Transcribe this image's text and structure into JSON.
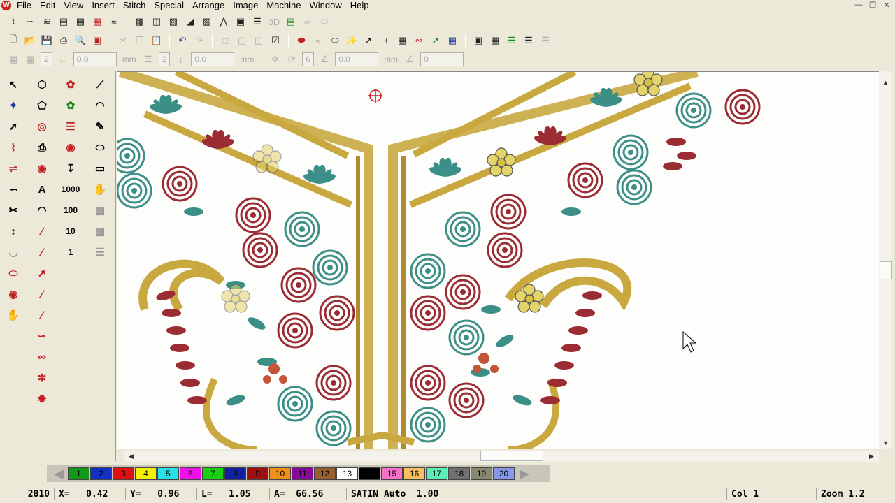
{
  "menu": [
    "File",
    "Edit",
    "View",
    "Insert",
    "Stitch",
    "Special",
    "Arrange",
    "Image",
    "Machine",
    "Window",
    "Help"
  ],
  "app_logo_letter": "W",
  "toolbar3": {
    "value_a": "2",
    "value_b": "0.0",
    "unit_a": "mm",
    "value_c": "2",
    "value_d": "0.0",
    "unit_b": "mm",
    "value_e": "6",
    "value_f": "0.0",
    "unit_c": "mm",
    "value_g": "0"
  },
  "palette": {
    "swatches": [
      {
        "n": "1",
        "c": "#129a1c",
        "t": "#000000"
      },
      {
        "n": "2",
        "c": "#1030c8",
        "t": "#000000"
      },
      {
        "n": "3",
        "c": "#e01010",
        "t": "#000000"
      },
      {
        "n": "4",
        "c": "#f4f000",
        "t": "#000000"
      },
      {
        "n": "5",
        "c": "#28e0e8",
        "t": "#000000"
      },
      {
        "n": "6",
        "c": "#f010e8",
        "t": "#000000"
      },
      {
        "n": "7",
        "c": "#18d010",
        "t": "#000000"
      },
      {
        "n": "8",
        "c": "#1020a0",
        "t": "#000000"
      },
      {
        "n": "9",
        "c": "#a01010",
        "t": "#000000"
      },
      {
        "n": "10",
        "c": "#f09018",
        "t": "#000000"
      },
      {
        "n": "11",
        "c": "#880898",
        "t": "#000000"
      },
      {
        "n": "12",
        "c": "#986030",
        "t": "#000000"
      },
      {
        "n": "13",
        "c": "#ffffff",
        "t": "#000000"
      },
      {
        "n": "14",
        "c": "#000000",
        "t": "#000000"
      },
      {
        "n": "15",
        "c": "#f870c8",
        "t": "#000000"
      },
      {
        "n": "16",
        "c": "#f8c060",
        "t": "#000000"
      },
      {
        "n": "17",
        "c": "#58f0b8",
        "t": "#000000"
      },
      {
        "n": "18",
        "c": "#707070",
        "t": "#000000"
      },
      {
        "n": "19",
        "c": "#888870",
        "t": "#000000"
      },
      {
        "n": "20",
        "c": "#8898e8",
        "t": "#000000"
      }
    ]
  },
  "status": {
    "count": "2810",
    "x": "X=   0.42",
    "y": "Y=   0.96",
    "l": "L=   1.05",
    "a": "A=  66.56",
    "stitch": "SATIN Auto  1.00",
    "col": "Col 1",
    "zoom": "Zoom 1.2"
  },
  "colors": {
    "gold": "#c9a840",
    "teal": "#3c8f86",
    "maroon": "#9c2c34",
    "background": "#ece9d8"
  }
}
